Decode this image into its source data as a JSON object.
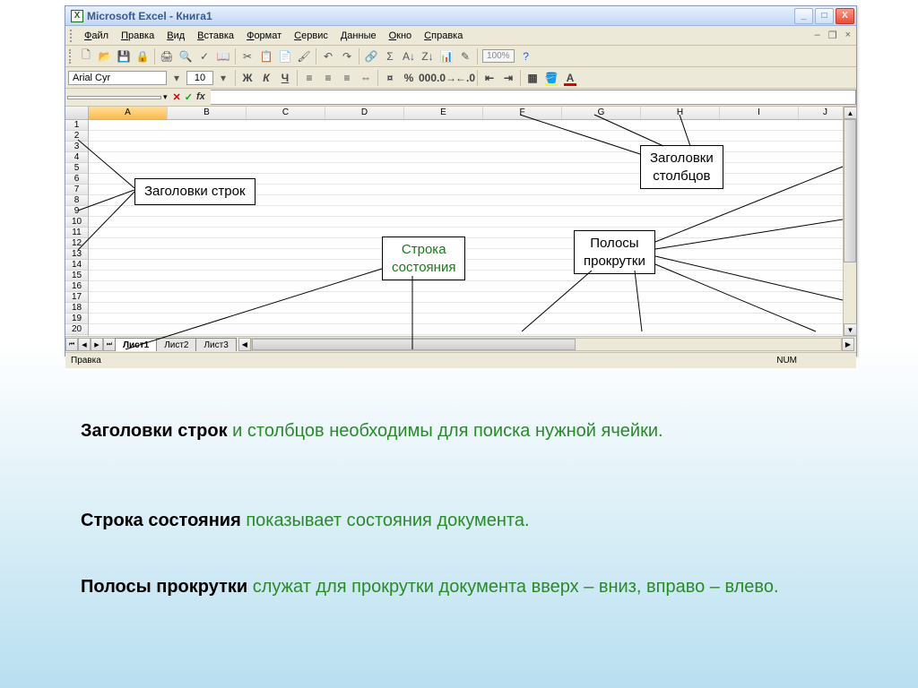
{
  "app": {
    "title": "Microsoft Excel - Книга1",
    "icon_letter": "X"
  },
  "window_controls": {
    "minimize": "_",
    "maximize": "□",
    "close": "X"
  },
  "mdi_controls": {
    "minimize": "–",
    "restore": "❐",
    "close": "×"
  },
  "menus": [
    "Файл",
    "Правка",
    "Вид",
    "Вставка",
    "Формат",
    "Сервис",
    "Данные",
    "Окно",
    "Справка"
  ],
  "toolbar_icons": [
    "new",
    "open",
    "save",
    "perm",
    "print",
    "preview",
    "spell",
    "research",
    "cut",
    "copy",
    "paste",
    "fmtpaint",
    "undo",
    "redo",
    "link",
    "sum",
    "sortaz",
    "sortza",
    "chart",
    "draw",
    "zoom",
    "help"
  ],
  "zoom": "100%",
  "format": {
    "font_name": "Arial Cyr",
    "font_size": "10",
    "buttons": [
      "Ж",
      "К",
      "Ч"
    ],
    "align": [
      "left",
      "center",
      "right",
      "merge"
    ],
    "num": [
      "currency",
      "percent",
      "comma",
      "inc-dec",
      "dec-dec"
    ],
    "indent": [
      "dec-indent",
      "inc-indent"
    ],
    "styles": [
      "borders",
      "fill",
      "font-color"
    ]
  },
  "formula_bar": {
    "name_box": "",
    "fx_cancel": "✕",
    "fx_enter": "✓",
    "fx_label": "fx",
    "formula": ""
  },
  "columns": [
    "A",
    "B",
    "C",
    "D",
    "E",
    "F",
    "G",
    "H",
    "I",
    "J"
  ],
  "rows": [
    1,
    2,
    3,
    4,
    5,
    6,
    7,
    8,
    9,
    10,
    11,
    12,
    13,
    14,
    15,
    16,
    17,
    18,
    19,
    20
  ],
  "sheets": {
    "active": "Лист1",
    "others": [
      "Лист2",
      "Лист3"
    ]
  },
  "status": {
    "mode": "Правка",
    "num": "NUM"
  },
  "callouts": {
    "row_headers": "Заголовки строк",
    "col_headers": "Заголовки\nстолбцов",
    "status_line": "Строка\nсостояния",
    "scrollbars": "Полосы\nпрокрутки"
  },
  "descriptions": {
    "d1_bold": "Заголовки строк",
    "d1_rest": " и столбцов необходимы для поиска нужной ячейки.",
    "d2_bold": "Строка состояния",
    "d2_rest": " показывает состояния документа.",
    "d3_bold": "Полосы прокрутки",
    "d3_rest": " служат для прокрутки документа вверх – вниз, вправо – влево."
  }
}
